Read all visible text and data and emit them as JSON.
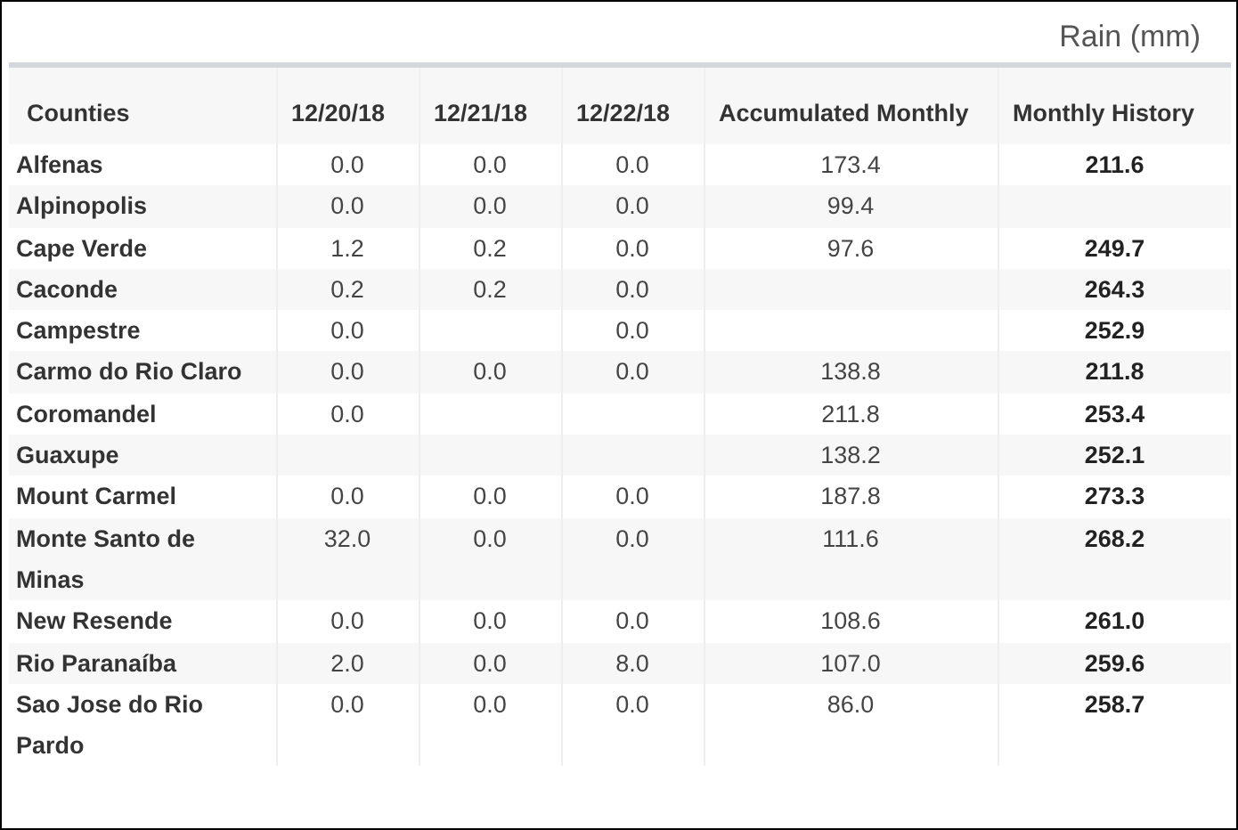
{
  "title": "Rain (mm)",
  "table": {
    "columns": [
      "Counties",
      "12/20/18",
      "12/21/18",
      "12/22/18",
      "Accumulated Monthly",
      "Monthly History"
    ],
    "rows": [
      [
        "Alfenas",
        "0.0",
        "0.0",
        "0.0",
        "173.4",
        "211.6"
      ],
      [
        "Alpinopolis",
        "0.0",
        "0.0",
        "0.0",
        "99.4",
        null
      ],
      [
        "Cape Verde",
        "1.2",
        "0.2",
        "0.0",
        "97.6",
        "249.7"
      ],
      [
        "Caconde",
        "0.2",
        "0.2",
        "0.0",
        null,
        "264.3"
      ],
      [
        "Campestre",
        "0.0",
        null,
        "0.0",
        null,
        "252.9"
      ],
      [
        "Carmo do Rio Claro",
        "0.0",
        "0.0",
        "0.0",
        "138.8",
        "211.8"
      ],
      [
        "Coromandel",
        "0.0",
        null,
        null,
        "211.8",
        "253.4"
      ],
      [
        "Guaxupe",
        null,
        null,
        null,
        "138.2",
        "252.1"
      ],
      [
        "Mount Carmel",
        "0.0",
        "0.0",
        "0.0",
        "187.8",
        "273.3"
      ],
      [
        "Monte Santo de Minas",
        "32.0",
        "0.0",
        "0.0",
        "111.6",
        "268.2"
      ],
      [
        "New Resende",
        "0.0",
        "0.0",
        "0.0",
        "108.6",
        "261.0"
      ],
      [
        "Rio Paranaíba",
        "2.0",
        "0.0",
        "8.0",
        "107.0",
        "259.6"
      ],
      [
        "Sao Jose do Rio Pardo",
        "0.0",
        "0.0",
        "0.0",
        "86.0",
        "258.7"
      ]
    ]
  }
}
